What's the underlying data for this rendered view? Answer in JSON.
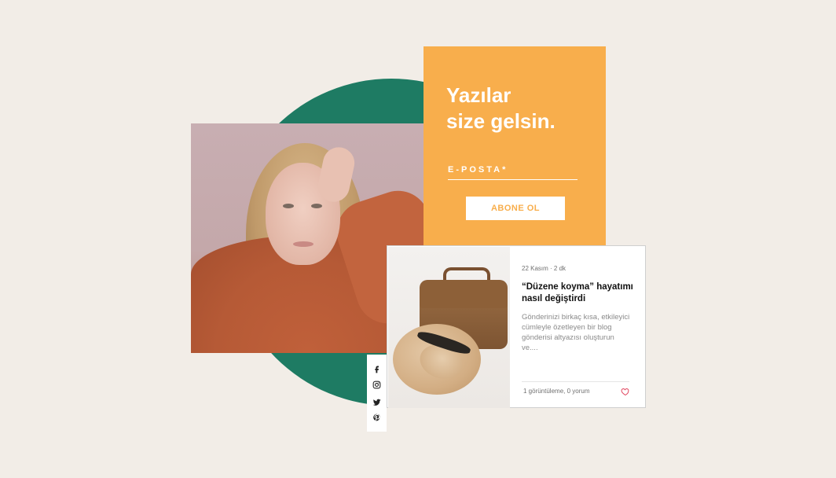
{
  "signup": {
    "title": "Yazılar\nsize gelsin.",
    "email_label": "E-POSTA*",
    "subscribe_button": "ABONE OL"
  },
  "post": {
    "meta": "22 Kasım · 2 dk",
    "title": "“Düzene koyma” hayatımı nasıl değiştirdi",
    "excerpt": "Gönderinizi birkaç kısa, etkileyici cümleyle özetleyen bir blog gönderisi altyazısı oluşturun ve....",
    "stats": "1 görüntüleme, 0 yorum"
  },
  "social": {
    "icons": [
      "facebook-icon",
      "instagram-icon",
      "twitter-icon",
      "pinterest-icon"
    ]
  },
  "colors": {
    "background": "#f2ede7",
    "accent_orange": "#f8ae4c",
    "accent_green": "#1e7b63",
    "like_red": "#e0405a"
  }
}
